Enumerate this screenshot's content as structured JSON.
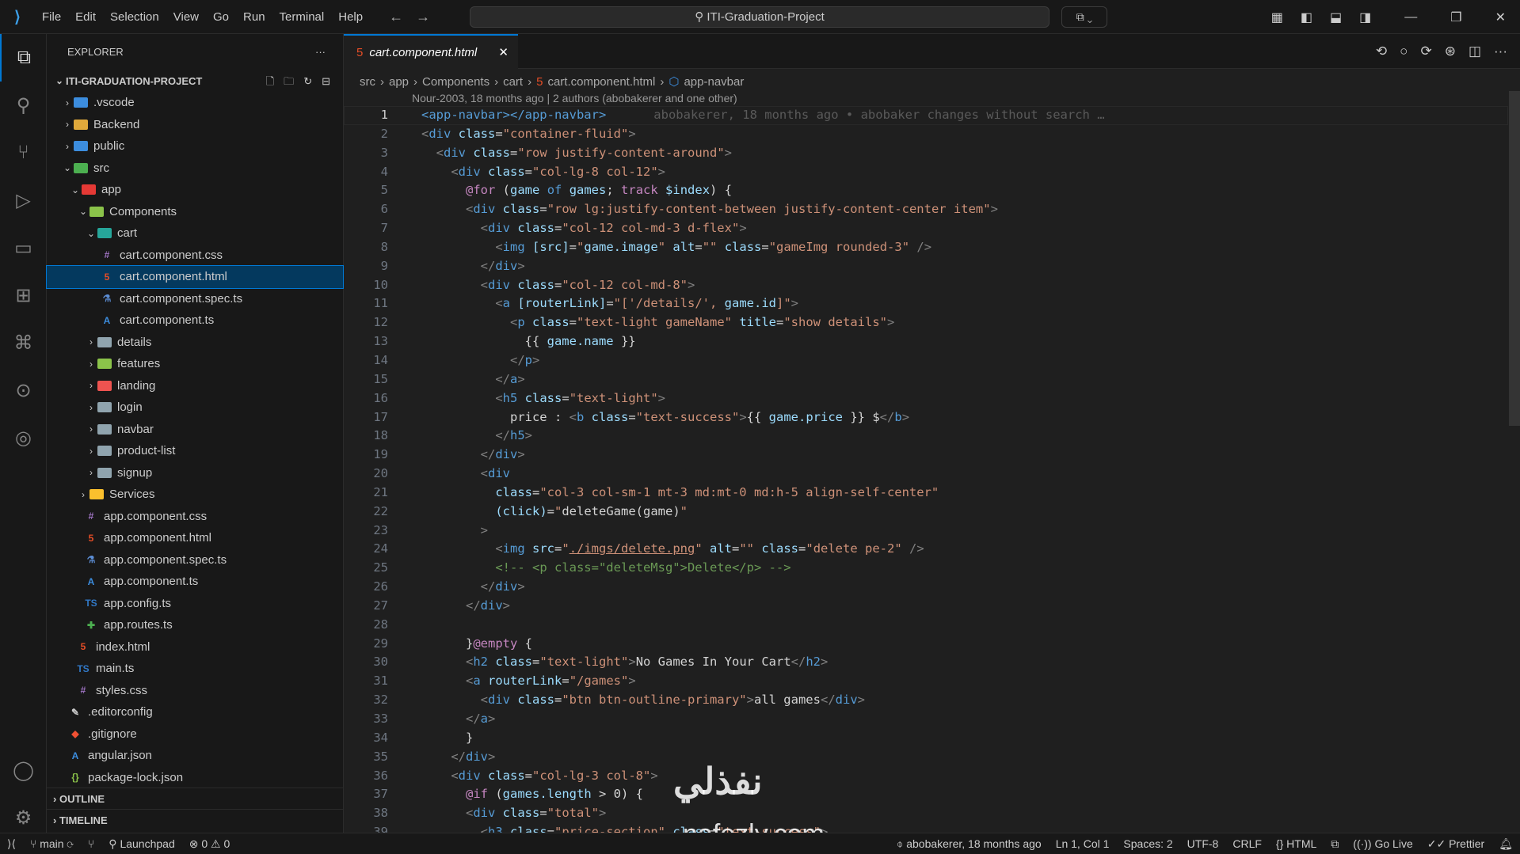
{
  "titlebar": {
    "menus": [
      "File",
      "Edit",
      "Selection",
      "View",
      "Go",
      "Run",
      "Terminal",
      "Help"
    ],
    "search": "ITI-Graduation-Project"
  },
  "explorer": {
    "title": "EXPLORER",
    "project": "ITI-GRADUATION-PROJECT",
    "tree": [
      {
        "d": 1,
        "n": ".vscode",
        "f": 1,
        "c": "#3c8dde"
      },
      {
        "d": 1,
        "n": "Backend",
        "f": 1,
        "c": "#e0a93b"
      },
      {
        "d": 1,
        "n": "public",
        "f": 1,
        "c": "#3c8dde"
      },
      {
        "d": 1,
        "n": "src",
        "f": 1,
        "o": 1,
        "c": "#4caf50"
      },
      {
        "d": 2,
        "n": "app",
        "f": 1,
        "o": 1,
        "c": "#e53935"
      },
      {
        "d": 3,
        "n": "Components",
        "f": 1,
        "o": 1,
        "c": "#8bc34a"
      },
      {
        "d": 4,
        "n": "cart",
        "f": 1,
        "o": 1,
        "c": "#26a69a"
      },
      {
        "d": 5,
        "n": "cart.component.css",
        "i": "css"
      },
      {
        "d": 5,
        "n": "cart.component.html",
        "i": "html",
        "sel": 1
      },
      {
        "d": 5,
        "n": "cart.component.spec.ts",
        "i": "spec"
      },
      {
        "d": 5,
        "n": "cart.component.ts",
        "i": "ang"
      },
      {
        "d": 4,
        "n": "details",
        "f": 1,
        "c": "#90a4ae"
      },
      {
        "d": 4,
        "n": "features",
        "f": 1,
        "c": "#8bc34a"
      },
      {
        "d": 4,
        "n": "landing",
        "f": 1,
        "c": "#ef5350"
      },
      {
        "d": 4,
        "n": "login",
        "f": 1,
        "c": "#90a4ae"
      },
      {
        "d": 4,
        "n": "navbar",
        "f": 1,
        "c": "#90a4ae"
      },
      {
        "d": 4,
        "n": "product-list",
        "f": 1,
        "c": "#90a4ae"
      },
      {
        "d": 4,
        "n": "signup",
        "f": 1,
        "c": "#90a4ae"
      },
      {
        "d": 3,
        "n": "Services",
        "f": 1,
        "c": "#fbc02d"
      },
      {
        "d": 3,
        "n": "app.component.css",
        "i": "css"
      },
      {
        "d": 3,
        "n": "app.component.html",
        "i": "html"
      },
      {
        "d": 3,
        "n": "app.component.spec.ts",
        "i": "spec"
      },
      {
        "d": 3,
        "n": "app.component.ts",
        "i": "ang"
      },
      {
        "d": 3,
        "n": "app.config.ts",
        "i": "ts"
      },
      {
        "d": 3,
        "n": "app.routes.ts",
        "i": "route"
      },
      {
        "d": 2,
        "n": "index.html",
        "i": "html"
      },
      {
        "d": 2,
        "n": "main.ts",
        "i": "ts"
      },
      {
        "d": 2,
        "n": "styles.css",
        "i": "css"
      },
      {
        "d": 1,
        "n": ".editorconfig",
        "i": "cfg"
      },
      {
        "d": 1,
        "n": ".gitignore",
        "i": "git"
      },
      {
        "d": 1,
        "n": "angular.json",
        "i": "ang"
      },
      {
        "d": 1,
        "n": "package-lock.json",
        "i": "json"
      }
    ],
    "outline": "OUTLINE",
    "timeline": "TIMELINE"
  },
  "tab": {
    "label": "cart.component.html"
  },
  "breadcrumb": [
    "src",
    "app",
    "Components",
    "cart",
    "cart.component.html",
    "app-navbar"
  ],
  "codelens": "Nour-2003, 18 months ago | 2 authors (abobakerer and one other)",
  "blame": "abobakerer, 18 months ago • abobaker changes without search …",
  "code": [
    [
      [
        "t",
        "<app-navbar></app-navbar>"
      ]
    ],
    [
      [
        "p",
        "<"
      ],
      [
        "t",
        "div "
      ],
      [
        "a",
        "class"
      ],
      [
        "x",
        "="
      ],
      [
        "s",
        "\"container-fluid\""
      ],
      [
        "p",
        ">"
      ]
    ],
    [
      [
        "x",
        "  "
      ],
      [
        "p",
        "<"
      ],
      [
        "t",
        "div "
      ],
      [
        "a",
        "class"
      ],
      [
        "x",
        "="
      ],
      [
        "s",
        "\"row justify-content-around\""
      ],
      [
        "p",
        ">"
      ]
    ],
    [
      [
        "x",
        "    "
      ],
      [
        "p",
        "<"
      ],
      [
        "t",
        "div "
      ],
      [
        "a",
        "class"
      ],
      [
        "x",
        "="
      ],
      [
        "s",
        "\"col-lg-8 col-12\""
      ],
      [
        "p",
        ">"
      ]
    ],
    [
      [
        "x",
        "      "
      ],
      [
        "k",
        "@for "
      ],
      [
        "x",
        "("
      ],
      [
        "v",
        "game "
      ],
      [
        "t",
        "of "
      ],
      [
        "v",
        "games"
      ],
      [
        "x",
        "; "
      ],
      [
        "k",
        "track "
      ],
      [
        "v",
        "$index"
      ],
      [
        "x",
        ") {"
      ]
    ],
    [
      [
        "x",
        "      "
      ],
      [
        "p",
        "<"
      ],
      [
        "t",
        "div "
      ],
      [
        "a",
        "class"
      ],
      [
        "x",
        "="
      ],
      [
        "s",
        "\"row lg:justify-content-between justify-content-center item\""
      ],
      [
        "p",
        ">"
      ]
    ],
    [
      [
        "x",
        "        "
      ],
      [
        "p",
        "<"
      ],
      [
        "t",
        "div "
      ],
      [
        "a",
        "class"
      ],
      [
        "x",
        "="
      ],
      [
        "s",
        "\"col-12 col-md-3 d-flex\""
      ],
      [
        "p",
        ">"
      ]
    ],
    [
      [
        "x",
        "          "
      ],
      [
        "p",
        "<"
      ],
      [
        "t",
        "img "
      ],
      [
        "a",
        "[src]"
      ],
      [
        "x",
        "="
      ],
      [
        "s",
        "\""
      ],
      [
        "v",
        "game.image"
      ],
      [
        "s",
        "\" "
      ],
      [
        "a",
        "alt"
      ],
      [
        "x",
        "="
      ],
      [
        "s",
        "\"\" "
      ],
      [
        "a",
        "class"
      ],
      [
        "x",
        "="
      ],
      [
        "s",
        "\"gameImg rounded-3\""
      ],
      [
        "p",
        " />"
      ]
    ],
    [
      [
        "x",
        "        "
      ],
      [
        "p",
        "</"
      ],
      [
        "t",
        "div"
      ],
      [
        "p",
        ">"
      ]
    ],
    [
      [
        "x",
        "        "
      ],
      [
        "p",
        "<"
      ],
      [
        "t",
        "div "
      ],
      [
        "a",
        "class"
      ],
      [
        "x",
        "="
      ],
      [
        "s",
        "\"col-12 col-md-8\""
      ],
      [
        "p",
        ">"
      ]
    ],
    [
      [
        "x",
        "          "
      ],
      [
        "p",
        "<"
      ],
      [
        "t",
        "a "
      ],
      [
        "a",
        "[routerLink]"
      ],
      [
        "x",
        "="
      ],
      [
        "s",
        "\"['/details/', "
      ],
      [
        "v",
        "game.id"
      ],
      [
        "s",
        "]\""
      ],
      [
        "p",
        ">"
      ]
    ],
    [
      [
        "x",
        "            "
      ],
      [
        "p",
        "<"
      ],
      [
        "t",
        "p "
      ],
      [
        "a",
        "class"
      ],
      [
        "x",
        "="
      ],
      [
        "s",
        "\"text-light gameName\" "
      ],
      [
        "a",
        "title"
      ],
      [
        "x",
        "="
      ],
      [
        "s",
        "\"show details\""
      ],
      [
        "p",
        ">"
      ]
    ],
    [
      [
        "x",
        "              {{ "
      ],
      [
        "v",
        "game.name"
      ],
      [
        "x",
        " }}"
      ]
    ],
    [
      [
        "x",
        "            "
      ],
      [
        "p",
        "</"
      ],
      [
        "t",
        "p"
      ],
      [
        "p",
        ">"
      ]
    ],
    [
      [
        "x",
        "          "
      ],
      [
        "p",
        "</"
      ],
      [
        "t",
        "a"
      ],
      [
        "p",
        ">"
      ]
    ],
    [
      [
        "x",
        "          "
      ],
      [
        "p",
        "<"
      ],
      [
        "t",
        "h5 "
      ],
      [
        "a",
        "class"
      ],
      [
        "x",
        "="
      ],
      [
        "s",
        "\"text-light\""
      ],
      [
        "p",
        ">"
      ]
    ],
    [
      [
        "x",
        "            price : "
      ],
      [
        "p",
        "<"
      ],
      [
        "t",
        "b "
      ],
      [
        "a",
        "class"
      ],
      [
        "x",
        "="
      ],
      [
        "s",
        "\"text-success\""
      ],
      [
        "p",
        ">"
      ],
      [
        "x",
        "{{ "
      ],
      [
        "v",
        "game.price"
      ],
      [
        "x",
        " }} $"
      ],
      [
        "p",
        "</"
      ],
      [
        "t",
        "b"
      ],
      [
        "p",
        ">"
      ]
    ],
    [
      [
        "x",
        "          "
      ],
      [
        "p",
        "</"
      ],
      [
        "t",
        "h5"
      ],
      [
        "p",
        ">"
      ]
    ],
    [
      [
        "x",
        "        "
      ],
      [
        "p",
        "</"
      ],
      [
        "t",
        "div"
      ],
      [
        "p",
        ">"
      ]
    ],
    [
      [
        "x",
        "        "
      ],
      [
        "p",
        "<"
      ],
      [
        "t",
        "div"
      ]
    ],
    [
      [
        "x",
        "          "
      ],
      [
        "a",
        "class"
      ],
      [
        "x",
        "="
      ],
      [
        "s",
        "\"col-3 col-sm-1 mt-3 md:mt-0 md:h-5 align-self-center\""
      ]
    ],
    [
      [
        "x",
        "          "
      ],
      [
        "a",
        "(click)"
      ],
      [
        "x",
        "="
      ],
      [
        "s",
        "\""
      ],
      [
        "x",
        "deleteGame(game)"
      ],
      [
        "s",
        "\""
      ]
    ],
    [
      [
        "x",
        "        "
      ],
      [
        "p",
        ">"
      ]
    ],
    [
      [
        "x",
        "          "
      ],
      [
        "p",
        "<"
      ],
      [
        "t",
        "img "
      ],
      [
        "a",
        "src"
      ],
      [
        "x",
        "="
      ],
      [
        "s",
        "\""
      ],
      [
        "u",
        "./imgs/delete.png"
      ],
      [
        "s",
        "\" "
      ],
      [
        "a",
        "alt"
      ],
      [
        "x",
        "="
      ],
      [
        "s",
        "\"\" "
      ],
      [
        "a",
        "class"
      ],
      [
        "x",
        "="
      ],
      [
        "s",
        "\"delete pe-2\""
      ],
      [
        "p",
        " />"
      ]
    ],
    [
      [
        "x",
        "          "
      ],
      [
        "c",
        "<!-- <p class=\"deleteMsg\">Delete</p> -->"
      ]
    ],
    [
      [
        "x",
        "        "
      ],
      [
        "p",
        "</"
      ],
      [
        "t",
        "div"
      ],
      [
        "p",
        ">"
      ]
    ],
    [
      [
        "x",
        "      "
      ],
      [
        "p",
        "</"
      ],
      [
        "t",
        "div"
      ],
      [
        "p",
        ">"
      ]
    ],
    [
      [
        "x",
        ""
      ]
    ],
    [
      [
        "x",
        "      }"
      ],
      [
        "k",
        "@empty "
      ],
      [
        "x",
        "{"
      ]
    ],
    [
      [
        "x",
        "      "
      ],
      [
        "p",
        "<"
      ],
      [
        "t",
        "h2 "
      ],
      [
        "a",
        "class"
      ],
      [
        "x",
        "="
      ],
      [
        "s",
        "\"text-light\""
      ],
      [
        "p",
        ">"
      ],
      [
        "x",
        "No Games In Your Cart"
      ],
      [
        "p",
        "</"
      ],
      [
        "t",
        "h2"
      ],
      [
        "p",
        ">"
      ]
    ],
    [
      [
        "x",
        "      "
      ],
      [
        "p",
        "<"
      ],
      [
        "t",
        "a "
      ],
      [
        "a",
        "routerLink"
      ],
      [
        "x",
        "="
      ],
      [
        "s",
        "\"/games\""
      ],
      [
        "p",
        ">"
      ]
    ],
    [
      [
        "x",
        "        "
      ],
      [
        "p",
        "<"
      ],
      [
        "t",
        "div "
      ],
      [
        "a",
        "class"
      ],
      [
        "x",
        "="
      ],
      [
        "s",
        "\"btn btn-outline-primary\""
      ],
      [
        "p",
        ">"
      ],
      [
        "x",
        "all games"
      ],
      [
        "p",
        "</"
      ],
      [
        "t",
        "div"
      ],
      [
        "p",
        ">"
      ]
    ],
    [
      [
        "x",
        "      "
      ],
      [
        "p",
        "</"
      ],
      [
        "t",
        "a"
      ],
      [
        "p",
        ">"
      ]
    ],
    [
      [
        "x",
        "      }"
      ]
    ],
    [
      [
        "x",
        "    "
      ],
      [
        "p",
        "</"
      ],
      [
        "t",
        "div"
      ],
      [
        "p",
        ">"
      ]
    ],
    [
      [
        "x",
        "    "
      ],
      [
        "p",
        "<"
      ],
      [
        "t",
        "div "
      ],
      [
        "a",
        "class"
      ],
      [
        "x",
        "="
      ],
      [
        "s",
        "\"col-lg-3 col-8\""
      ],
      [
        "p",
        ">"
      ]
    ],
    [
      [
        "x",
        "      "
      ],
      [
        "k",
        "@if "
      ],
      [
        "x",
        "("
      ],
      [
        "v",
        "games.length"
      ],
      [
        "x",
        " > 0) {"
      ]
    ],
    [
      [
        "x",
        "      "
      ],
      [
        "p",
        "<"
      ],
      [
        "t",
        "div "
      ],
      [
        "a",
        "class"
      ],
      [
        "x",
        "="
      ],
      [
        "s",
        "\"total\""
      ],
      [
        "p",
        ">"
      ]
    ],
    [
      [
        "x",
        "        "
      ],
      [
        "p",
        "<"
      ],
      [
        "t",
        "h3 "
      ],
      [
        "a",
        "class"
      ],
      [
        "x",
        "="
      ],
      [
        "s",
        "\"price-section\" "
      ],
      [
        "a",
        "class"
      ],
      [
        "x",
        "="
      ],
      [
        "s",
        "\"text-success\""
      ],
      [
        "p",
        ">"
      ]
    ]
  ],
  "status": {
    "branch": "main",
    "launchpad": "Launchpad",
    "errors": "0",
    "warnings": "0",
    "blame": "abobakerer, 18 months ago",
    "pos": "Ln 1, Col 1",
    "spaces": "Spaces: 2",
    "enc": "UTF-8",
    "eol": "CRLF",
    "lang": "HTML",
    "golive": "Go Live",
    "prettier": "Prettier"
  },
  "watermark": {
    "arabic": "نفذلي",
    "latin": "nafezly.com"
  }
}
